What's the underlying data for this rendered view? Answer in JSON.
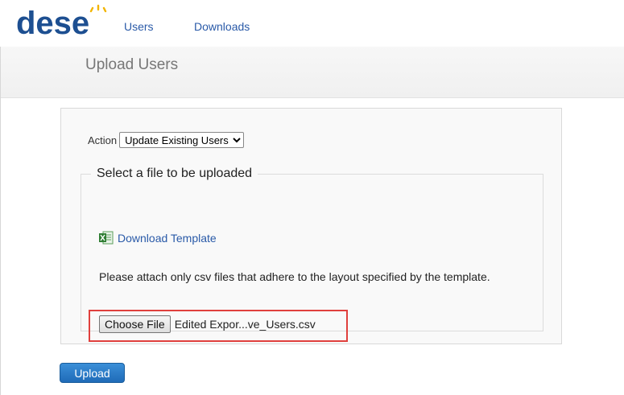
{
  "nav": {
    "logo_text": "dese",
    "links": [
      "Users",
      "Downloads"
    ]
  },
  "header": {
    "title": "Upload Users"
  },
  "form": {
    "action_label": "Action",
    "action_selected": "Update Existing Users",
    "fieldset_legend": "Select a file to be uploaded",
    "download_link": "Download Template",
    "instructions": "Please attach only csv files that adhere to the layout specified by the template.",
    "choose_file_label": "Choose File",
    "selected_file": "Edited Expor...ve_Users.csv",
    "upload_label": "Upload"
  },
  "colors": {
    "link": "#2a5aa8",
    "logo": "#1d4f91",
    "logo_accent": "#f2b400",
    "highlight_box": "#e0403d",
    "upload_button": "#2b7cc8"
  },
  "icons": {
    "template_icon": "excel-icon",
    "select_icon": "chevron-down-icon"
  }
}
